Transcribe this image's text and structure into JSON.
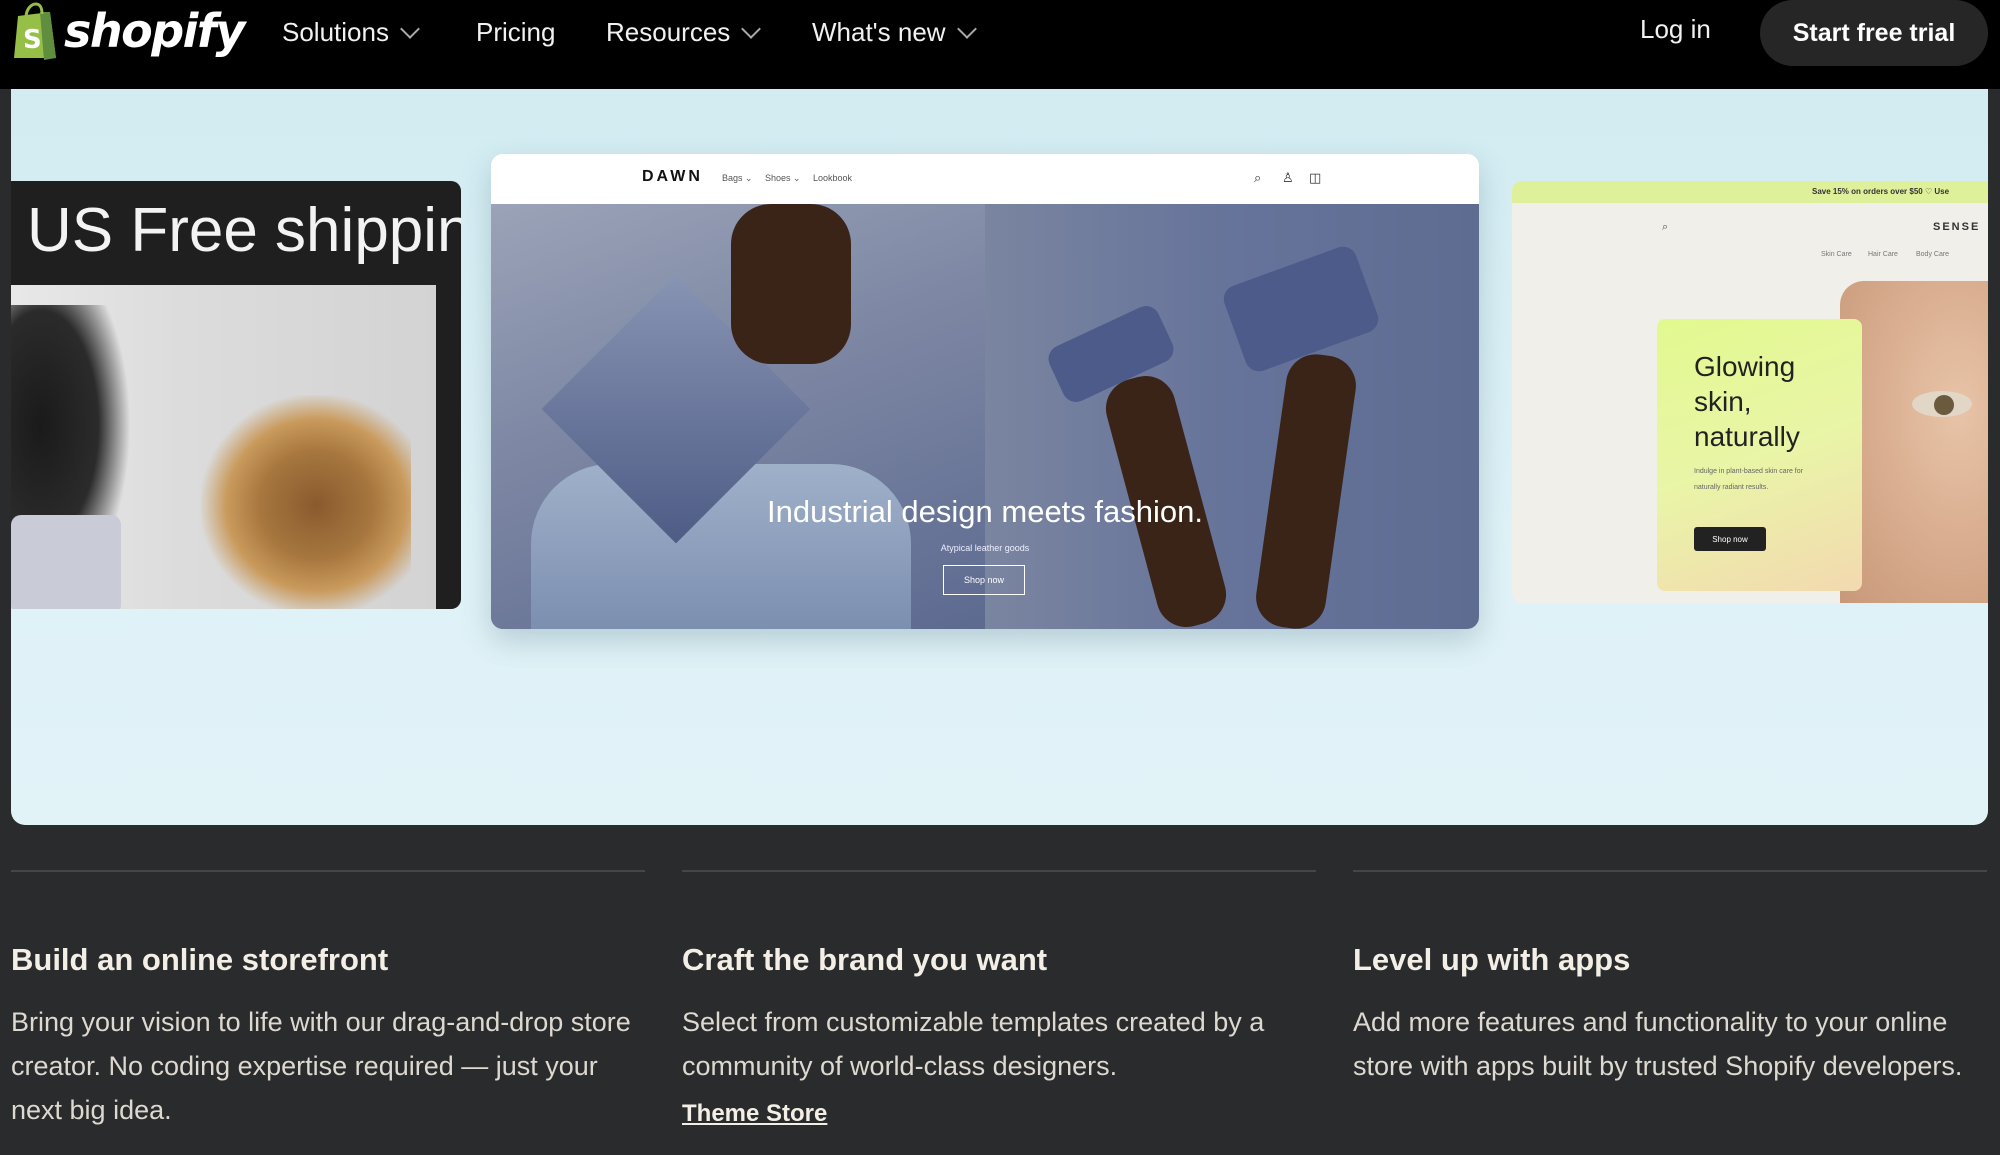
{
  "nav": {
    "logo_text": "shopify",
    "items": [
      {
        "label": "Solutions",
        "has_dropdown": true
      },
      {
        "label": "Pricing",
        "has_dropdown": false
      },
      {
        "label": "Resources",
        "has_dropdown": true
      },
      {
        "label": "What's new",
        "has_dropdown": true
      }
    ],
    "login": "Log in",
    "cta": "Start free trial"
  },
  "hero": {
    "left_card": {
      "text": "US Free shippin"
    },
    "center_card": {
      "logo": "DAWN",
      "menu": [
        "Bags ⌄",
        "Shoes ⌄",
        "Lookbook"
      ],
      "icons": [
        "search-icon",
        "account-icon",
        "cart-icon"
      ],
      "headline": "Industrial design meets fashion.",
      "subtext": "Atypical leather goods",
      "button": "Shop now"
    },
    "right_card": {
      "promo": "Save 15% on orders over $50 ♡ Use",
      "logo": "SENSE",
      "menu": [
        "Skin Care",
        "Hair Care",
        "Body Care"
      ],
      "title": "Glowing skin, naturally",
      "copy": "Indulge in plant-based skin care for naturally radiant results.",
      "button": "Shop now"
    }
  },
  "features": [
    {
      "title": "Build an online storefront",
      "body": "Bring your vision to life with our drag-and-drop store creator. No coding expertise required — just your next big idea.",
      "link": ""
    },
    {
      "title": "Craft the brand you want",
      "body": "Select from customizable templates created by a community of world-class designers.",
      "link": "Theme Store"
    },
    {
      "title": "Level up with apps",
      "body": "Add more features and functionality to your online store with apps built by trusted Shopify developers.",
      "link": ""
    }
  ],
  "colors": {
    "nav_bg": "#000000",
    "page_bg": "#2a2b2d",
    "hero_bg": "#d8eff5",
    "cta_bg": "#262626",
    "logo_green": "#95bf47"
  }
}
